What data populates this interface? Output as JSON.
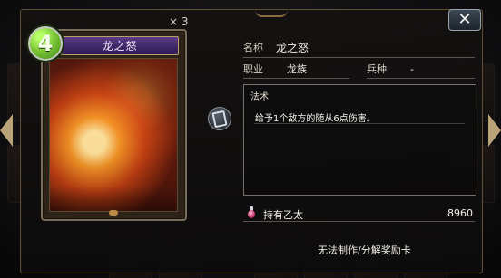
{
  "card": {
    "name": "龙之怒",
    "cost": "4",
    "count": "× 3"
  },
  "details": {
    "name_label": "名称",
    "name_value": "龙之怒",
    "class_label": "职业",
    "class_value": "龙族",
    "unit_label": "兵种",
    "unit_value": "-",
    "type_label": "法术",
    "description": "给予1个敌方的随从6点伤害。"
  },
  "ether": {
    "label": "持有乙太",
    "value": "8960"
  },
  "footer": {
    "craft_status": "无法制作/分解奖励卡"
  },
  "icons": {
    "close": "close-icon",
    "left": "left-arrow-icon",
    "right": "right-arrow-icon",
    "mini": "card-zoom-icon",
    "ether": "ether-bottle-icon"
  },
  "colors": {
    "cost_green": "#79c534",
    "name_bar_purple": "#4a2f75",
    "panel_border": "#5b4d36"
  }
}
